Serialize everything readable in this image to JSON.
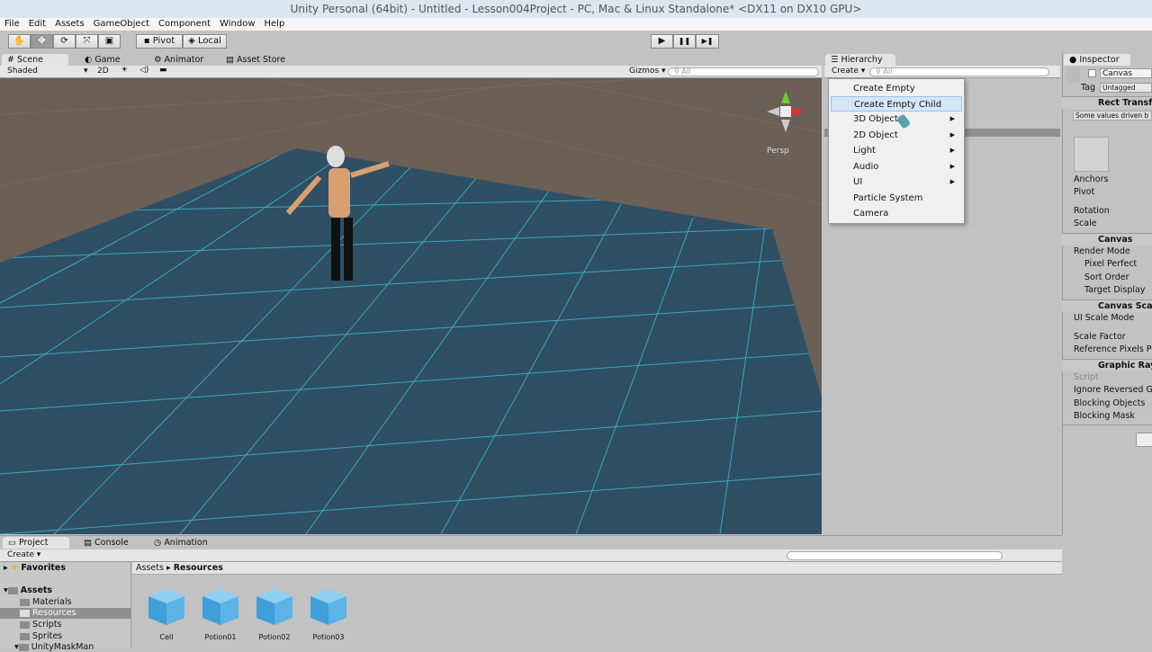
{
  "window": {
    "title": "Unity Personal (64bit) - Untitled - Lesson004Project - PC, Mac & Linux Standalone* <DX11 on DX10 GPU>"
  },
  "menu": [
    "File",
    "Edit",
    "Assets",
    "GameObject",
    "Component",
    "Window",
    "Help"
  ],
  "toolbar": {
    "tools": [
      "hand-tool",
      "move-tool",
      "rotate-tool",
      "scale-tool",
      "rect-tool"
    ],
    "pivot": "Pivot",
    "local": "Local",
    "play": "▶",
    "pause": "❚❚",
    "step": "▶❚"
  },
  "scene": {
    "tabs": [
      "Scene",
      "Game",
      "Animator",
      "Asset Store"
    ],
    "shading": "Shaded",
    "mode2d": "2D",
    "gizmos": "Gizmos",
    "search_placeholder": "All",
    "persp": "Persp",
    "colors": {
      "ground": "#2e4f64",
      "background": "#6b5f56",
      "grid": "#3fc7d6"
    }
  },
  "hierarchy": {
    "title": "Hierarchy",
    "create": "Create",
    "search_placeholder": "All",
    "menu": [
      {
        "label": "Create Empty",
        "sub": false
      },
      {
        "label": "Create Empty Child",
        "sub": false,
        "highlighted": true
      },
      {
        "label": "3D Object",
        "sub": true
      },
      {
        "label": "2D Object",
        "sub": true
      },
      {
        "label": "Light",
        "sub": true
      },
      {
        "label": "Audio",
        "sub": true
      },
      {
        "label": "UI",
        "sub": true
      },
      {
        "label": "Particle System",
        "sub": false
      },
      {
        "label": "Camera",
        "sub": false
      }
    ]
  },
  "inspector": {
    "title": "Inspector",
    "object_name": "Canvas",
    "tag_label": "Tag",
    "tag": "Untagged",
    "rect_transform": {
      "title": "Rect Transf",
      "note": "Some values driven b",
      "fields": [
        "Anchors",
        "Pivot",
        "Rotation",
        "Scale"
      ]
    },
    "canvas": {
      "title": "Canvas",
      "fields": [
        "Render Mode",
        "Pixel Perfect",
        "Sort Order",
        "Target Display"
      ]
    },
    "canvas_scaler": {
      "title": "Canvas Sca",
      "fields": [
        "UI Scale Mode",
        "Scale Factor",
        "Reference Pixels Pe"
      ]
    },
    "graphic_raycaster": {
      "title": "Graphic Ray",
      "fields": [
        "Script",
        "Ignore Reversed G",
        "Blocking Objects",
        "Blocking Mask"
      ]
    }
  },
  "project": {
    "tabs": [
      "Project",
      "Console",
      "Animation"
    ],
    "create": "Create",
    "favorites": "Favorites",
    "assets": "Assets",
    "folders": [
      "Materials",
      "Resources",
      "Scripts",
      "Sprites",
      "UnityMaskMan"
    ],
    "selected_folder": "Resources",
    "breadcrumb": [
      "Assets",
      "Resources"
    ],
    "items": [
      "Cell",
      "Potion01",
      "Potion02",
      "Potion03"
    ]
  }
}
